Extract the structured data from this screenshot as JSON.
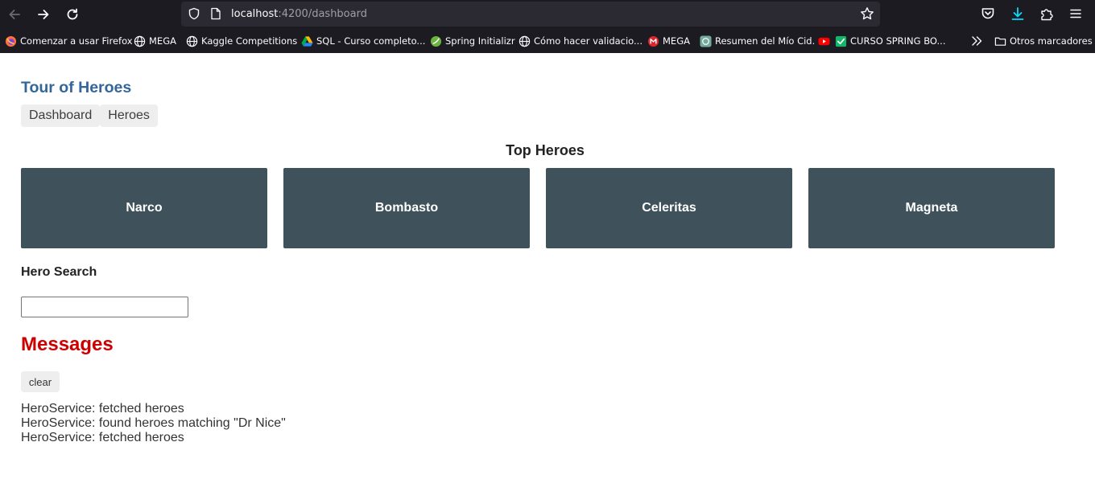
{
  "browser": {
    "url_host": "localhost",
    "url_rest": ":4200/dashboard",
    "bookmarks": [
      {
        "label": "Comenzar a usar Firefox",
        "icon": "firefox-icon"
      },
      {
        "label": "MEGA",
        "icon": "globe-icon"
      },
      {
        "label": "Kaggle Competitions",
        "icon": "globe-icon"
      },
      {
        "label": "SQL - Curso completo...",
        "icon": "google-drive-icon"
      },
      {
        "label": "Spring Initializr",
        "icon": "spring-icon"
      },
      {
        "label": "Cómo hacer validacio...",
        "icon": "globe-icon"
      },
      {
        "label": "MEGA",
        "icon": "mega-icon"
      },
      {
        "label": "Resumen del Mío Cid.",
        "icon": "chatgpt-icon"
      },
      {
        "label": "CURSO SPRING BO...",
        "icon": "youtube-icon"
      }
    ],
    "other_bookmarks": "Otros marcadores"
  },
  "app": {
    "title": "Tour of Heroes",
    "nav": [
      "Dashboard",
      "Heroes"
    ]
  },
  "dashboard": {
    "title": "Top Heroes",
    "heroes": [
      "Narco",
      "Bombasto",
      "Celeritas",
      "Magneta"
    ]
  },
  "search": {
    "label": "Hero Search",
    "value": ""
  },
  "messages": {
    "title": "Messages",
    "clear_label": "clear",
    "items": [
      "HeroService: fetched heroes",
      "HeroService: found heroes matching \"Dr Nice\"",
      "HeroService: fetched heroes"
    ]
  },
  "colors": {
    "chrome_bg": "#1c1b22",
    "urlbar_bg": "#2b2a33",
    "title_blue": "#336699",
    "hero_card": "#3f525c",
    "messages_red": "#cc0000",
    "download_accent": "#00ddff"
  }
}
